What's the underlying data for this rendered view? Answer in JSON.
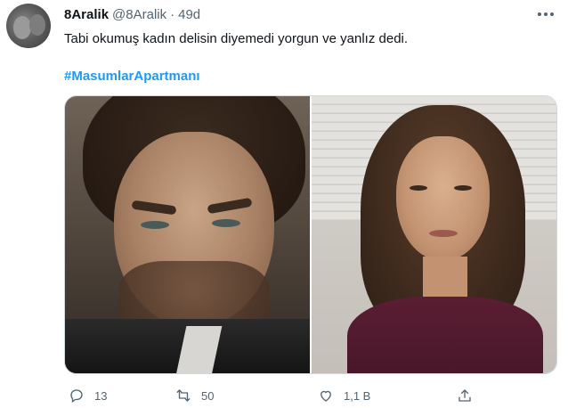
{
  "tweet": {
    "display_name": "8Aralik",
    "handle": "@8Aralik",
    "separator": "·",
    "time": "49d",
    "text": "Tabi okumuş kadın delisin diyemedi yorgun ve yanlız dedi.",
    "hashtag": "#MasumlarApartmanı"
  },
  "actions": {
    "reply_count": "13",
    "retweet_count": "50",
    "like_count": "1,1 B"
  },
  "icons": {
    "more": "more-icon",
    "reply": "reply-icon",
    "retweet": "retweet-icon",
    "like": "like-icon",
    "share": "share-icon"
  },
  "colors": {
    "hashtag": "#1d9bf0",
    "secondary_text": "#536471",
    "primary_text": "#0f1419"
  }
}
